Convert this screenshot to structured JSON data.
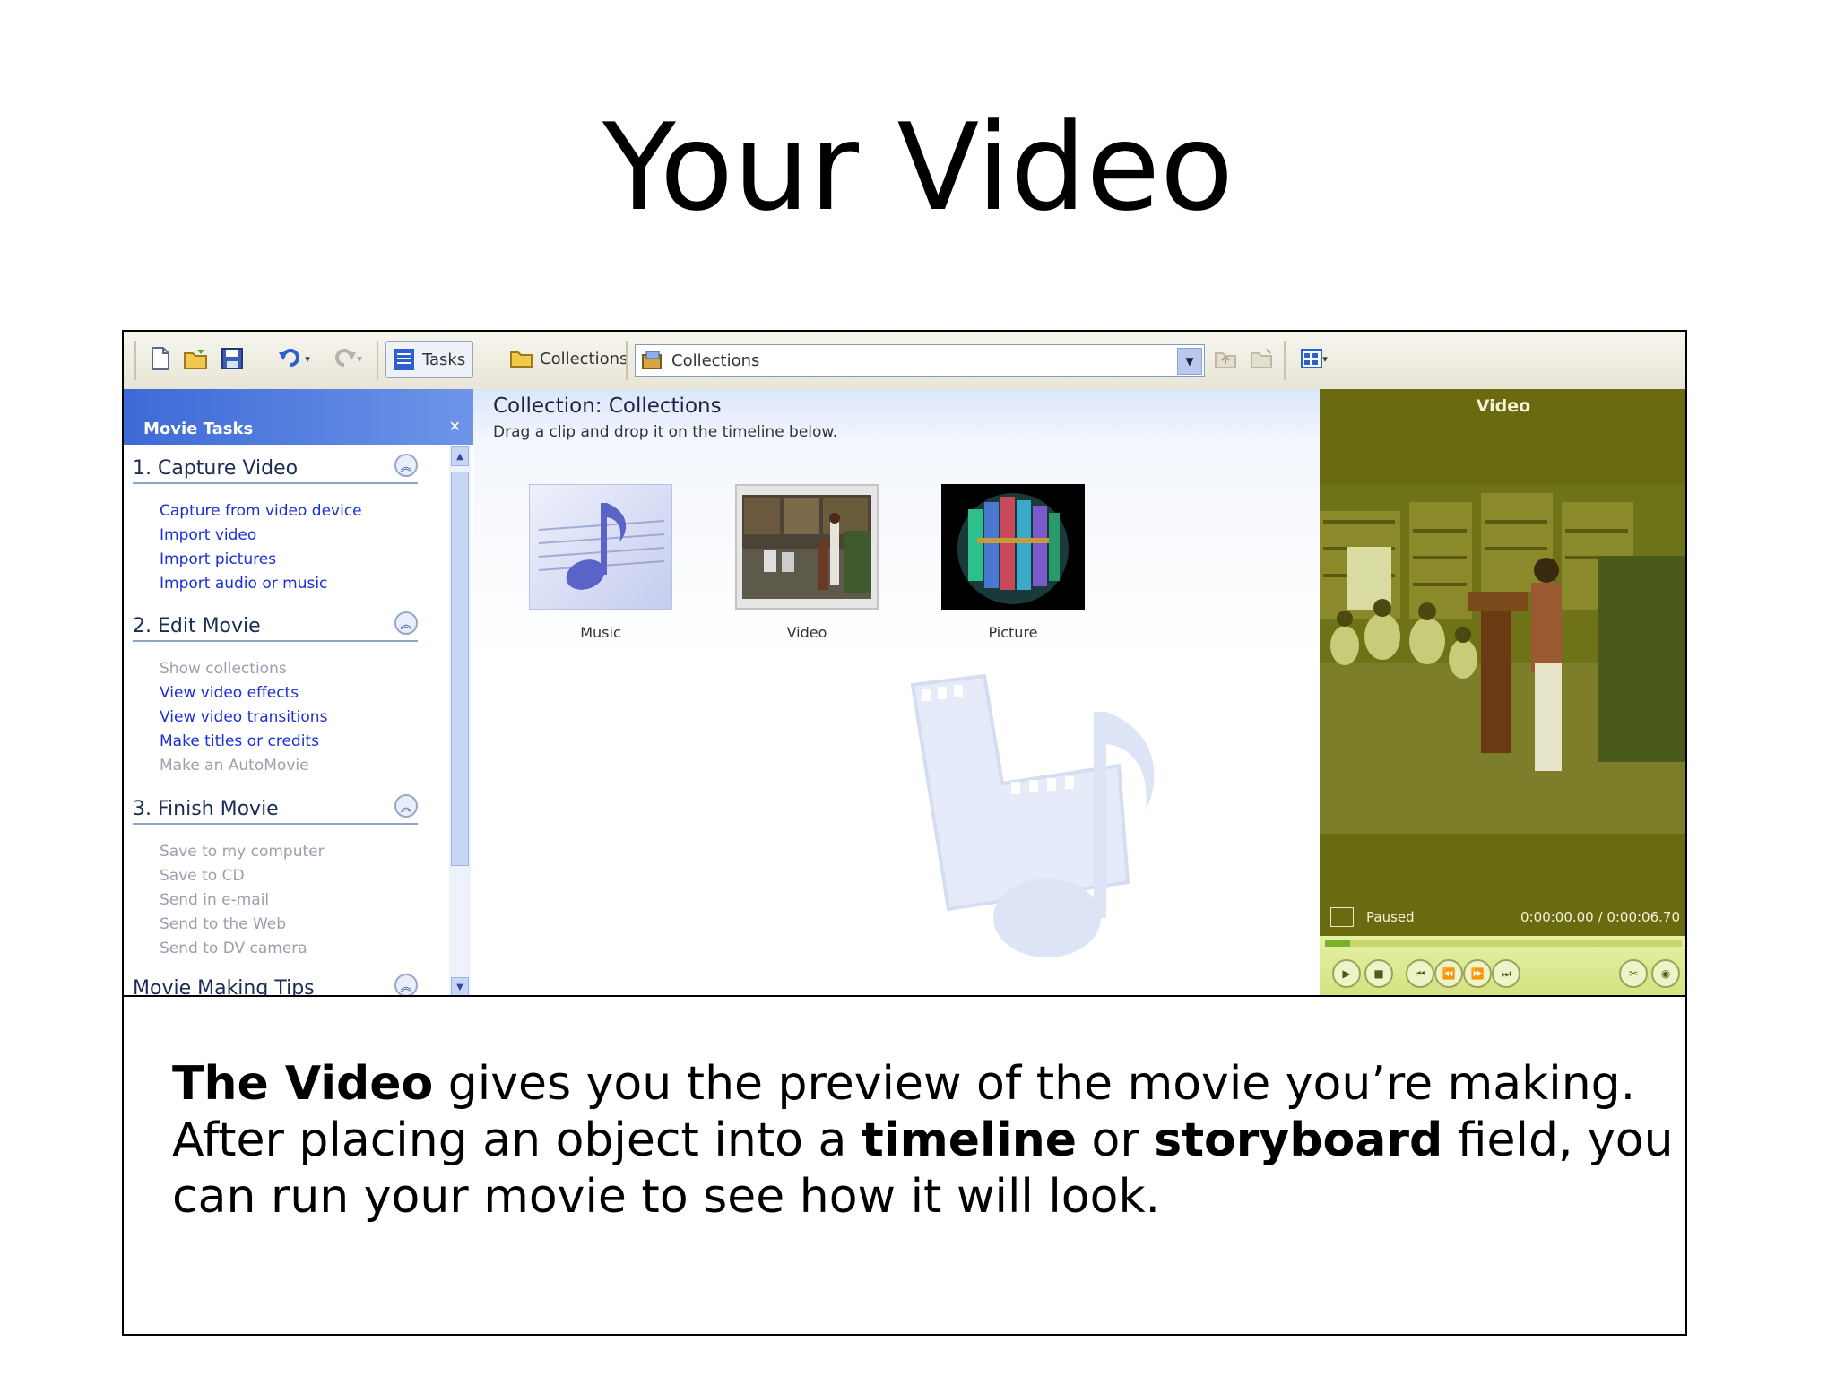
{
  "slide": {
    "title": "Your Video"
  },
  "toolbar": {
    "tasks_label": "Tasks",
    "collections_label": "Collections",
    "collection_select_value": "Collections"
  },
  "tasks_pane": {
    "header": "Movie Tasks",
    "sections": [
      {
        "label": "1. Capture Video",
        "items": [
          {
            "label": "Capture from video device",
            "enabled": true
          },
          {
            "label": "Import video",
            "enabled": true
          },
          {
            "label": "Import pictures",
            "enabled": true
          },
          {
            "label": "Import audio or music",
            "enabled": true
          }
        ]
      },
      {
        "label": "2. Edit Movie",
        "items": [
          {
            "label": "Show collections",
            "enabled": false
          },
          {
            "label": "View video effects",
            "enabled": true
          },
          {
            "label": "View video transitions",
            "enabled": true
          },
          {
            "label": "Make titles or credits",
            "enabled": true
          },
          {
            "label": "Make an AutoMovie",
            "enabled": false
          }
        ]
      },
      {
        "label": "3. Finish Movie",
        "items": [
          {
            "label": "Save to my computer",
            "enabled": false
          },
          {
            "label": "Save to CD",
            "enabled": false
          },
          {
            "label": "Send in e-mail",
            "enabled": false
          },
          {
            "label": "Send to the Web",
            "enabled": false
          },
          {
            "label": "Send to DV camera",
            "enabled": false
          }
        ]
      },
      {
        "label": "Movie Making Tips",
        "items": []
      }
    ]
  },
  "collection": {
    "title": "Collection: Collections",
    "subtitle": "Drag a clip and drop it on the timeline below.",
    "items": [
      {
        "label": "Music"
      },
      {
        "label": "Video"
      },
      {
        "label": "Picture"
      }
    ]
  },
  "preview": {
    "title": "Video",
    "status": "Paused",
    "time": "0:00:00.00 / 0:00:06.70"
  },
  "caption": {
    "part1_bold": "The Video",
    "part2": " gives you the preview of the movie you’re making. After placing an object into a ",
    "part3_bold": "timeline",
    "part4": " or ",
    "part5_bold": "storyboard",
    "part6": " field, you can run your movie to see how it will look."
  },
  "colors": {
    "task_link": "#1b2fd8",
    "task_disabled": "#9aa0ab",
    "tasks_header": "#3c6ad6",
    "preview_bg": "#6a6a10",
    "controls_bg": "#e6f0a6"
  },
  "icons": [
    "new-project-icon",
    "open-project-icon",
    "save-icon",
    "undo-icon",
    "redo-icon",
    "tasks-icon",
    "collections-folder-icon",
    "collections-select-icon",
    "up-level-icon",
    "new-folder-icon",
    "views-icon",
    "music-note-icon",
    "play-icon",
    "stop-icon"
  ]
}
